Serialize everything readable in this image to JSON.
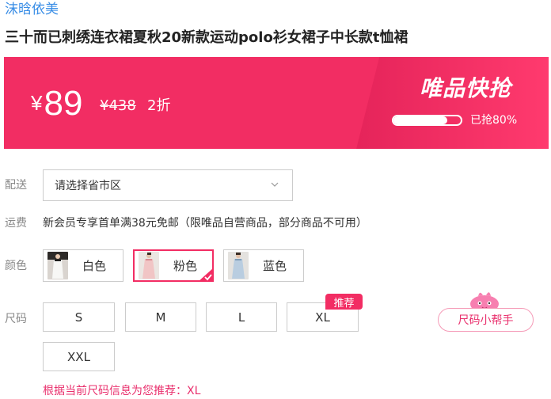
{
  "brand": {
    "name": "沫晗依美"
  },
  "product": {
    "title": "三十而已刺绣连衣裙夏秋20新款运动polo衫女裙子中长款t恤裙"
  },
  "price": {
    "currency_symbol": "¥",
    "current": "89",
    "original": "¥438",
    "discount": "2折"
  },
  "flash_sale": {
    "title": "唯品快抢",
    "progress_percent": 80,
    "progress_text": "已抢80%"
  },
  "delivery": {
    "label": "配送",
    "placeholder": "请选择省市区",
    "icon": "chevron-down-icon"
  },
  "shipping": {
    "label": "运费",
    "note": "新会员专享首单满38元免邮（限唯品自营商品，部分商品不可用）"
  },
  "colors": {
    "label": "颜色",
    "options": [
      {
        "name": "白色",
        "selected": false
      },
      {
        "name": "粉色",
        "selected": true
      },
      {
        "name": "蓝色",
        "selected": false
      }
    ]
  },
  "sizes": {
    "label": "尺码",
    "options": [
      "S",
      "M",
      "L",
      "XL",
      "XXL"
    ],
    "recommend_badge": "推荐",
    "recommended": "XL",
    "helper_button": "尺码小帮手",
    "recommend_note": "根据当前尺码信息为您推荐：XL"
  },
  "theme": {
    "accent": "#f22d63",
    "link": "#3a8ee6"
  }
}
